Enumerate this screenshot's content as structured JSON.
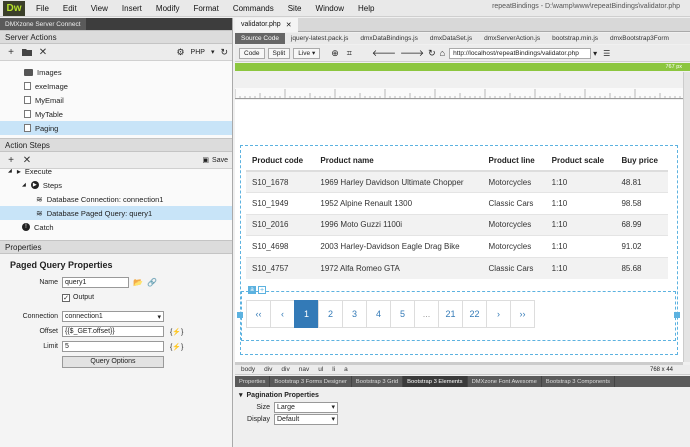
{
  "menubar": {
    "logo": "Dw",
    "items": [
      "File",
      "Edit",
      "View",
      "Insert",
      "Modify",
      "Format",
      "Commands",
      "Site",
      "Window",
      "Help"
    ],
    "title_path": "repeatBindings - D:\\wamp\\www\\repeatBindings\\validator.php"
  },
  "left_panel": {
    "tab_label": "DMXzone Server Connect",
    "server_actions_title": "Server Actions",
    "php_label": "PHP",
    "tree": [
      "Images",
      "exeImage",
      "MyEmail",
      "MyTable",
      "Paging"
    ],
    "action_steps_title": "Action Steps",
    "save_label": "Save",
    "steps": [
      {
        "label": "Execute",
        "indent": 0
      },
      {
        "label": "Steps",
        "indent": 1
      },
      {
        "label": "Database Connection: connection1",
        "indent": 2
      },
      {
        "label": "Database Paged Query: query1",
        "indent": 2
      },
      {
        "label": "Catch",
        "indent": 1
      }
    ],
    "properties_title": "Properties",
    "pqp_title": "Paged Query Properties",
    "name_label": "Name",
    "name_value": "query1",
    "output_label": "Output",
    "connection_label": "Connection",
    "connection_value": "connection1",
    "offset_label": "Offset",
    "offset_value": "{{$_GET.offset}}",
    "limit_label": "Limit",
    "limit_value": "5",
    "query_options_label": "Query Options"
  },
  "doc": {
    "active_tab": "validator.php",
    "related_files": [
      "Source Code",
      "jquery-latest.pack.js",
      "dmxDataBindings.js",
      "dmxDataSet.js",
      "dmxServerAction.js",
      "bootstrap.min.js",
      "dmxBootstrap3Form"
    ],
    "code_label": "Code",
    "split_label": "Split",
    "live_label": "Live",
    "url": "http://localhost/repeatBindings/validator.php",
    "width_indicator": "767 px"
  },
  "table": {
    "headers": [
      "Product code",
      "Product name",
      "Product line",
      "Product scale",
      "Buy price"
    ],
    "rows": [
      [
        "S10_1678",
        "1969 Harley Davidson Ultimate Chopper",
        "Motorcycles",
        "1:10",
        "48.81"
      ],
      [
        "S10_1949",
        "1952 Alpine Renault 1300",
        "Classic Cars",
        "1:10",
        "98.58"
      ],
      [
        "S10_2016",
        "1996 Moto Guzzi 1100i",
        "Motorcycles",
        "1:10",
        "68.99"
      ],
      [
        "S10_4698",
        "2003 Harley-Davidson Eagle Drag Bike",
        "Motorcycles",
        "1:10",
        "91.02"
      ],
      [
        "S10_4757",
        "1972 Alfa Romeo GTA",
        "Classic Cars",
        "1:10",
        "85.68"
      ]
    ]
  },
  "pagination": {
    "first": "‹‹",
    "prev": "‹",
    "pages": [
      "1",
      "2",
      "3",
      "4",
      "5"
    ],
    "ellipsis": "...",
    "tail": [
      "21",
      "22"
    ],
    "next": "›",
    "last": "››",
    "active": "1"
  },
  "status": {
    "tags": [
      "body",
      "div",
      "div",
      "nav",
      "ul",
      "li",
      "a"
    ],
    "size": "768 x 44"
  },
  "bottom": {
    "tabs": [
      "Properties",
      "Bootstrap 3 Forms Designer",
      "Bootstrap 3 Grid",
      "Bootstrap 3 Elements",
      "DMXzone Font Awesome",
      "Bootstrap 3 Components"
    ],
    "active_tab": "Bootstrap 3 Elements",
    "section_title": "Pagination Properties",
    "size_label": "Size",
    "size_value": "Large",
    "display_label": "Display",
    "display_value": "Default"
  },
  "colors": {
    "accent": "#337ab7",
    "selection": "#c8e4f8",
    "green": "#8cc63f"
  }
}
